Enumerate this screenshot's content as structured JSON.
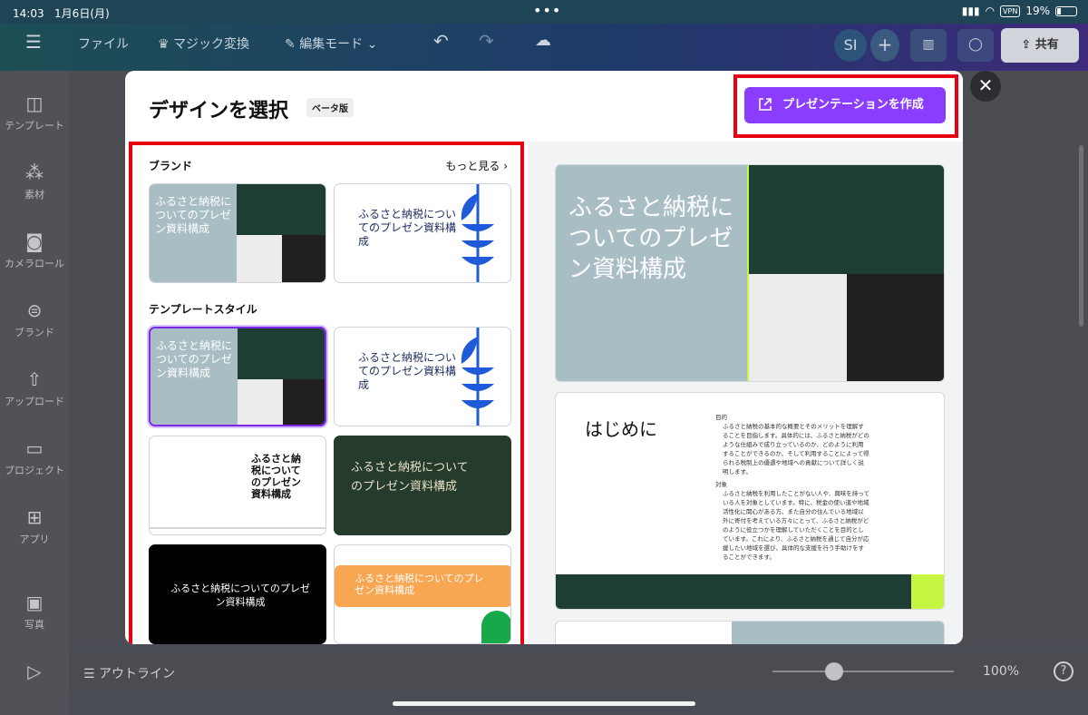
{
  "status": {
    "time": "14:03",
    "date": "1月6日(月)",
    "vpn": "VPN",
    "battery": "19%"
  },
  "toolbar": {
    "file": "ファイル",
    "magic": "マジック変換",
    "edit_mode": "編集モード",
    "avatar": "SI",
    "share": "共有"
  },
  "sidebar": [
    {
      "label": "テンプレート",
      "icon": "template-icon"
    },
    {
      "label": "素材",
      "icon": "elements-icon"
    },
    {
      "label": "カメラロール",
      "icon": "camera-icon"
    },
    {
      "label": "ブランド",
      "icon": "brand-icon"
    },
    {
      "label": "アップロード",
      "icon": "upload-icon"
    },
    {
      "label": "プロジェクト",
      "icon": "folder-icon"
    },
    {
      "label": "アプリ",
      "icon": "apps-icon"
    },
    {
      "label": "写真",
      "icon": "photo-icon"
    }
  ],
  "bottombar": {
    "outline": "アウトライン",
    "zoom": "100%"
  },
  "modal": {
    "title": "デザインを選択",
    "beta": "ベータ版",
    "create_button": "プレゼンテーションを作成",
    "brand_heading": "ブランド",
    "see_more": "もっと見る",
    "template_heading": "テンプレートスタイル",
    "slide_title": "ふるさと納税についてのプレゼン資料構成",
    "slide_title_short": "ふるさと納税についてのプレゼン資料構成",
    "preview_heading": "はじめに",
    "preview_purpose_label": "目的",
    "preview_purpose_text": "ふるさと納税の基本的な概要とそのメリットを理解することを目指します。具体的には、ふるさと納税がどのような仕組みで成り立っているのか、どのように利用することができるのか、そして利用することによって得られる税制上の優遇や地域への貢献について詳しく説明します。",
    "preview_target_label": "対象",
    "preview_target_text": "ふるさと納税を利用したことがない人や、興味を持っている人を対象としています。特に、税金の使い道や地域活性化に関心がある方、また自分の住んでいる地域以外に寄付を考えている方々にとって、ふるさと納税がどのように役立つかを理解していただくことを目的としています。これにより、ふるさと納税を通じて自分が応援したい地域を選び、具体的な支援を行う手助けをすることができます。"
  },
  "colors": {
    "accent": "#8b3dff",
    "highlight": "#e60012",
    "dark_green": "#1d3d35",
    "slate": "#a9bec4",
    "blue": "#1f5bd8",
    "orange": "#f9a653",
    "lime": "#c6f542"
  }
}
